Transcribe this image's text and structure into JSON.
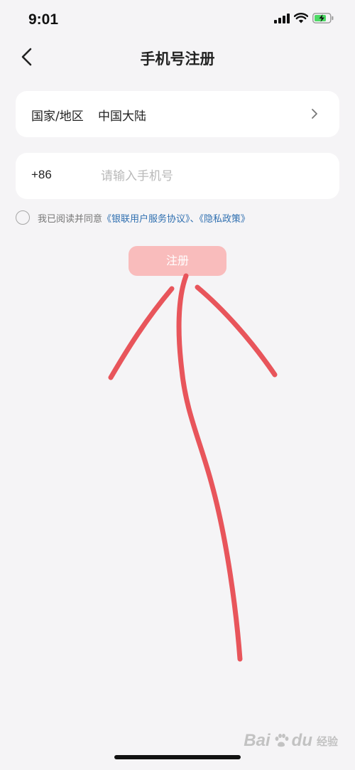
{
  "status_bar": {
    "time": "9:01",
    "icons": [
      "cellular-signal-icon",
      "wifi-icon",
      "battery-charging-icon"
    ]
  },
  "nav": {
    "title": "手机号注册",
    "back_icon": "chevron-left-icon"
  },
  "form": {
    "region": {
      "label": "国家/地区",
      "value": "中国大陆",
      "icon": "chevron-right-icon"
    },
    "phone": {
      "country_code": "+86",
      "placeholder": "请输入手机号",
      "value": ""
    },
    "agreement": {
      "checked": false,
      "prefix": "我已阅读并同意",
      "link1": "《银联用户服务协议》",
      "separator": "、",
      "link2": "《隐私政策》"
    },
    "register_label": "注册"
  },
  "watermark": {
    "brand": "Bai",
    "brand_suffix": "du",
    "sub": "经验"
  },
  "colors": {
    "background": "#f5f4f6",
    "card": "#ffffff",
    "button_disabled": "#f9bcbc",
    "link": "#2f6fb0",
    "annotation_stroke": "#e8555b"
  }
}
